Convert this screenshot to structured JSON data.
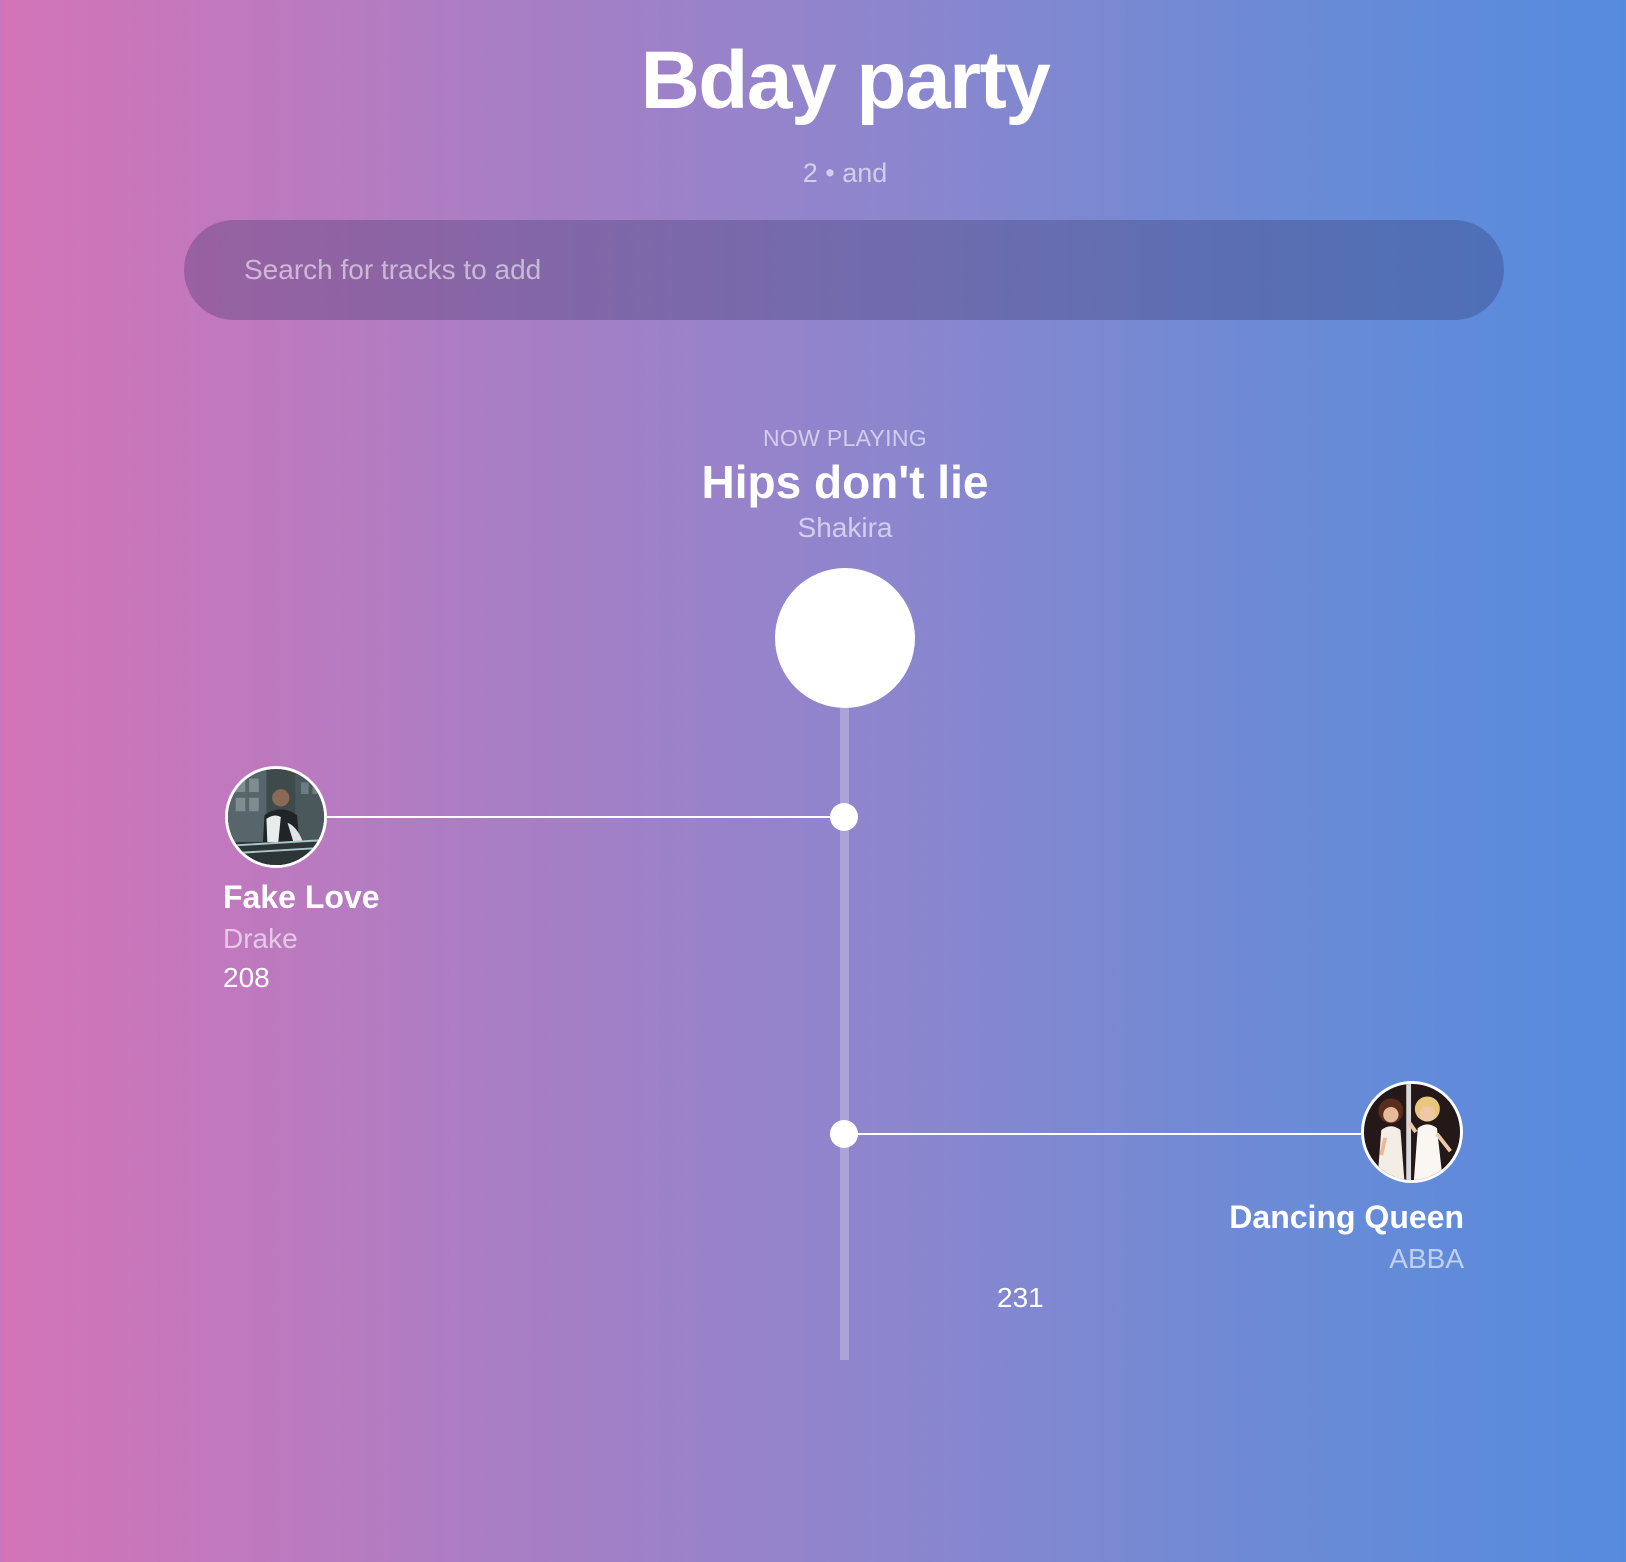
{
  "party": {
    "title": "Bday party",
    "subtitle": "2 • and"
  },
  "search": {
    "placeholder": "Search for tracks to add",
    "value": ""
  },
  "now_playing": {
    "label": "NOW PLAYING",
    "title": "Hips don't lie",
    "artist": "Shakira"
  },
  "queue": [
    {
      "title": "Fake Love",
      "artist": "Drake",
      "count": "208",
      "artwork_icon": "album-art-drake"
    },
    {
      "title": "Dancing Queen",
      "artist": "ABBA",
      "count": "231",
      "artwork_icon": "album-art-abba"
    }
  ],
  "colors": {
    "gradient_left": "#d474b8",
    "gradient_right": "#558bde",
    "text": "#ffffff"
  }
}
